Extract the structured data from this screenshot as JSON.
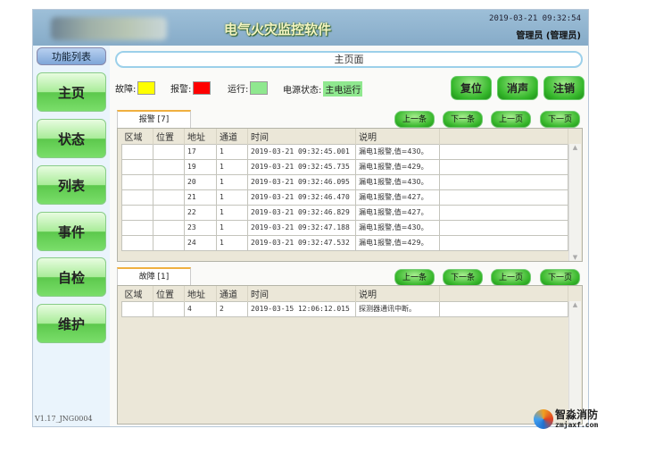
{
  "header": {
    "title": "电气火灾监控软件",
    "datetime": "2019-03-21 09:32:54",
    "user": "管理员 (管理员)"
  },
  "sidebar": {
    "title": "功能列表",
    "items": [
      {
        "label": "主页"
      },
      {
        "label": "状态"
      },
      {
        "label": "列表"
      },
      {
        "label": "事件"
      },
      {
        "label": "自检"
      },
      {
        "label": "维护"
      }
    ],
    "version": "V1.17_JNG0004"
  },
  "main": {
    "page_title": "主页面",
    "legend": {
      "fault_label": "故障:",
      "alarm_label": "报警:",
      "run_label": "运行:",
      "power_label": "电源状态:",
      "power_value": "主电运行",
      "fault_color": "#ffff00",
      "alarm_color": "#ff0000",
      "run_color": "#8fe88f"
    },
    "buttons": {
      "reset": "复位",
      "silence": "消声",
      "logout": "注销"
    },
    "nav": {
      "prev_item": "上一条",
      "next_item": "下一条",
      "prev_page": "上一页",
      "next_page": "下一页"
    },
    "columns": [
      "区域",
      "位置",
      "地址",
      "通道",
      "时间",
      "说明"
    ],
    "alarm": {
      "tab": "报警 [7]",
      "rows": [
        [
          "",
          "",
          "17",
          "1",
          "2019-03-21 09:32:45.001",
          "漏电1报警,值=430。"
        ],
        [
          "",
          "",
          "19",
          "1",
          "2019-03-21 09:32:45.735",
          "漏电1报警,值=429。"
        ],
        [
          "",
          "",
          "20",
          "1",
          "2019-03-21 09:32:46.095",
          "漏电1报警,值=430。"
        ],
        [
          "",
          "",
          "21",
          "1",
          "2019-03-21 09:32:46.470",
          "漏电1报警,值=427。"
        ],
        [
          "",
          "",
          "22",
          "1",
          "2019-03-21 09:32:46.829",
          "漏电1报警,值=427。"
        ],
        [
          "",
          "",
          "23",
          "1",
          "2019-03-21 09:32:47.188",
          "漏电1报警,值=430。"
        ],
        [
          "",
          "",
          "24",
          "1",
          "2019-03-21 09:32:47.532",
          "漏电1报警,值=429。"
        ]
      ]
    },
    "fault": {
      "tab": "故障 [1]",
      "rows": [
        [
          "",
          "",
          "4",
          "2",
          "2019-03-15 12:06:12.015",
          "探测器通讯中断。"
        ]
      ]
    }
  },
  "watermark": {
    "name": "智淼消防",
    "url": "zmjaxf.com"
  }
}
